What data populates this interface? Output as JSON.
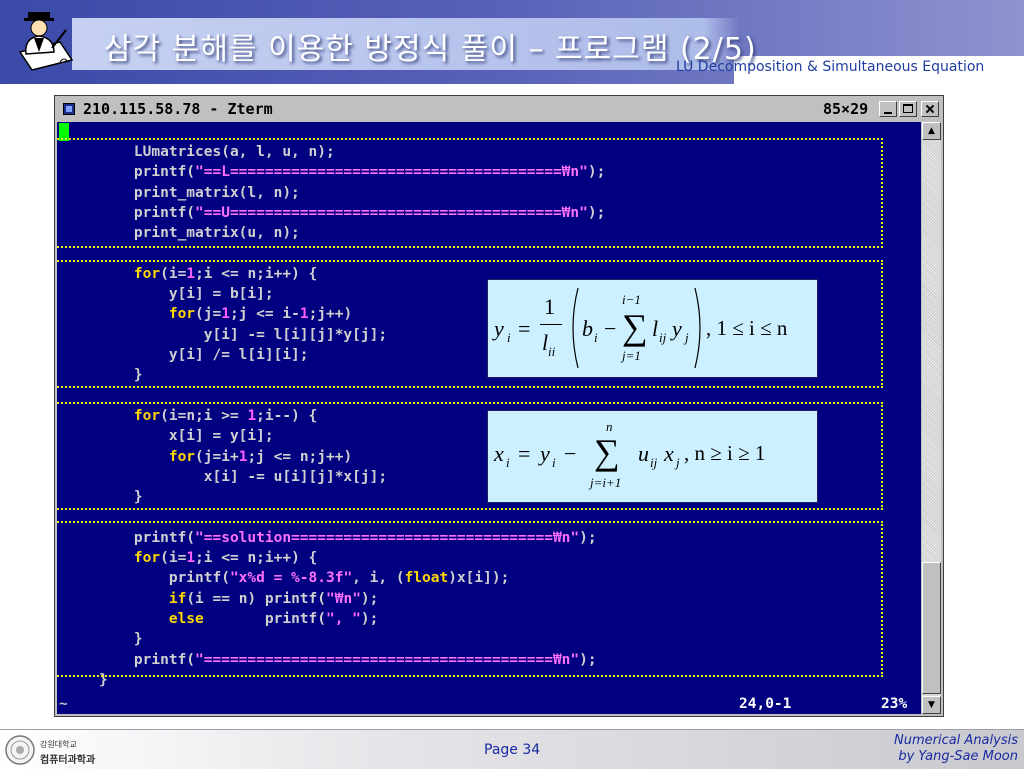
{
  "slide": {
    "title": "삼각 분해를 이용한 방정식 풀이 – 프로그램 (2/5)",
    "subtitle": "LU Decomposition & Simultaneous Equation"
  },
  "window": {
    "title": "210.115.58.78 - Zterm",
    "size": "85×29",
    "buttons": [
      "minimize",
      "maximize",
      "close"
    ]
  },
  "terminal": {
    "bg_color": "#000080",
    "cursor_color": "#00ff00",
    "lines": [
      [
        [
          "t",
          "    LUmatrices(a, l, u, n);"
        ]
      ],
      [
        [
          "t",
          "    printf("
        ],
        [
          "s",
          "\"==L======================================₩n\""
        ],
        [
          "t",
          ");"
        ]
      ],
      [
        [
          "t",
          "    print_matrix(l, n);"
        ]
      ],
      [
        [
          "t",
          "    printf("
        ],
        [
          "s",
          "\"==U======================================₩n\""
        ],
        [
          "t",
          ");"
        ]
      ],
      [
        [
          "t",
          "    print_matrix(u, n);"
        ]
      ],
      [
        [
          "t",
          ""
        ]
      ],
      [
        [
          "t",
          "    "
        ],
        [
          "k",
          "for"
        ],
        [
          "t",
          "(i="
        ],
        [
          "n",
          "1"
        ],
        [
          "t",
          ";i <= n;i++) {"
        ]
      ],
      [
        [
          "t",
          "        y[i] = b[i];"
        ]
      ],
      [
        [
          "t",
          "        "
        ],
        [
          "k",
          "for"
        ],
        [
          "t",
          "(j="
        ],
        [
          "n",
          "1"
        ],
        [
          "t",
          ";j <= i-"
        ],
        [
          "n",
          "1"
        ],
        [
          "t",
          ";j++)"
        ]
      ],
      [
        [
          "t",
          "            y[i] -= l[i][j]*y[j];"
        ]
      ],
      [
        [
          "t",
          "        y[i] /= l[i][i];"
        ]
      ],
      [
        [
          "t",
          "    }"
        ]
      ],
      [
        [
          "t",
          ""
        ]
      ],
      [
        [
          "t",
          "    "
        ],
        [
          "k",
          "for"
        ],
        [
          "t",
          "(i=n;i >= "
        ],
        [
          "n",
          "1"
        ],
        [
          "t",
          ";i--) {"
        ]
      ],
      [
        [
          "t",
          "        x[i] = y[i];"
        ]
      ],
      [
        [
          "t",
          "        "
        ],
        [
          "k",
          "for"
        ],
        [
          "t",
          "(j=i+"
        ],
        [
          "n",
          "1"
        ],
        [
          "t",
          ";j <= n;j++)"
        ]
      ],
      [
        [
          "t",
          "            x[i] -= u[i][j]*x[j];"
        ]
      ],
      [
        [
          "t",
          "    }"
        ]
      ],
      [
        [
          "t",
          ""
        ]
      ],
      [
        [
          "t",
          "    printf("
        ],
        [
          "s",
          "\"==solution==============================₩n\""
        ],
        [
          "t",
          ");"
        ]
      ],
      [
        [
          "t",
          "    "
        ],
        [
          "k",
          "for"
        ],
        [
          "t",
          "(i="
        ],
        [
          "n",
          "1"
        ],
        [
          "t",
          ";i <= n;i++) {"
        ]
      ],
      [
        [
          "t",
          "        printf("
        ],
        [
          "s",
          "\"x%d = %-8.3f\""
        ],
        [
          "t",
          ", i, ("
        ],
        [
          "k",
          "float"
        ],
        [
          "t",
          ")x[i]);"
        ]
      ],
      [
        [
          "t",
          "        "
        ],
        [
          "k",
          "if"
        ],
        [
          "t",
          "(i == n) printf("
        ],
        [
          "s",
          "\"₩n\""
        ],
        [
          "t",
          ");"
        ]
      ],
      [
        [
          "t",
          "        "
        ],
        [
          "k",
          "else"
        ],
        [
          "t",
          "       printf("
        ],
        [
          "s",
          "\", \""
        ],
        [
          "t",
          ");"
        ]
      ],
      [
        [
          "t",
          "    }"
        ]
      ],
      [
        [
          "t",
          "    printf("
        ],
        [
          "s",
          "\"========================================₩n\""
        ],
        [
          "t",
          ");"
        ]
      ],
      [
        [
          "t",
          "}"
        ]
      ]
    ],
    "status_position": "24,0-1",
    "status_percent": "23%"
  },
  "equations": {
    "forward": {
      "lhs": "y",
      "sub_i": "i",
      "eq": "=",
      "frac_num": "1",
      "frac_den": "l",
      "frac_den_sub": "ii",
      "b": "b",
      "minus": "−",
      "sigma": "∑",
      "sum_upper": "i−1",
      "sum_lower": "j=1",
      "term_l": "l",
      "term_l_sub": "ij",
      "term_y": "y",
      "term_y_sub": "j",
      "range": ",   1 ≤ i ≤ n"
    },
    "backward": {
      "lhs": "x",
      "sub_i": "i",
      "eq": "=",
      "y": "y",
      "minus": "−",
      "sigma": "∑",
      "sum_upper": "n",
      "sum_lower": "j=i+1",
      "term_u": "u",
      "term_u_sub": "ij",
      "term_x": "x",
      "term_x_sub": "j",
      "range": ",    n ≥ i ≥ 1"
    }
  },
  "footer": {
    "university_line1": "강원대학교",
    "university_line2": "컴퓨터과학과",
    "page": "Page 34",
    "course_line1": "Numerical Analysis",
    "course_line2": "by Yang-Sae Moon"
  },
  "colors": {
    "keyword": "#ffd700",
    "number": "#ff60ff",
    "string": "#ff70ff",
    "code_text": "#d0d0d0",
    "group_border": "#f0f000",
    "equation_bg": "#ccf0ff",
    "banner": "#3b4aa8"
  }
}
